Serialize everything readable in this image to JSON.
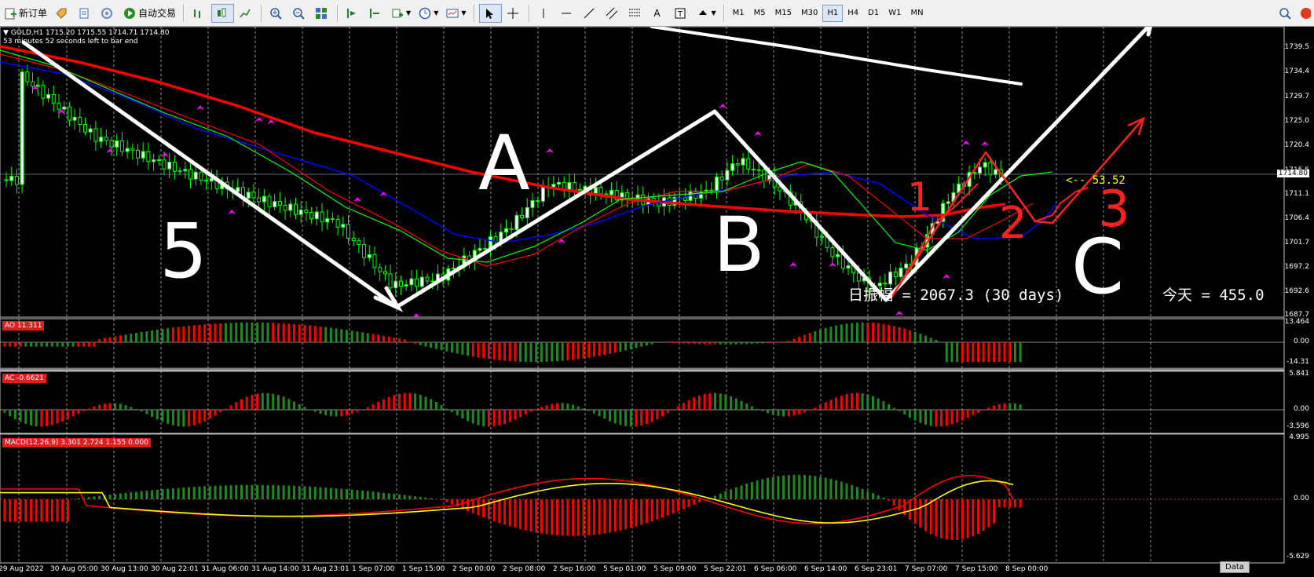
{
  "toolbar": {
    "new_order": "新订单",
    "auto_trading": "自动交易",
    "timeframes": [
      "M1",
      "M5",
      "M15",
      "M30",
      "H1",
      "H4",
      "D1",
      "W1",
      "MN"
    ],
    "active_timeframe": "H1"
  },
  "main_chart": {
    "header": "GOLD,H1  1715.20 1715.55 1714.71 1714.80",
    "timer": "53 minutes 52 seconds left to bar end",
    "price_scale": [
      "1739.5",
      "1734.4",
      "1729.7",
      "1725.0",
      "1720.4",
      "1715.5",
      "1714.80",
      "1711.1",
      "1706.4",
      "1701.7",
      "1697.2",
      "1692.6",
      "1687.7"
    ],
    "current_price": "1714.80",
    "annotation_price": "<-- 53.52",
    "footer_daily": "日振幅 = 2067.3  (30 days)",
    "footer_today": "今天 = 455.0",
    "handwriting": [
      "5",
      "A",
      "B",
      "C",
      "1",
      "2",
      "3"
    ]
  },
  "ao": {
    "badge": "AO 11.311",
    "scale": [
      "13.464",
      "0.00",
      "-14.31"
    ]
  },
  "ac": {
    "badge": "AC -0.6621",
    "scale": [
      "5.841",
      "0.00",
      "-3.596"
    ]
  },
  "macd": {
    "badge": "MACD(12,26,9) 3.301 2.724 1.155 0.000",
    "scale": [
      "4.995",
      "0.00",
      "-5.629"
    ]
  },
  "time_axis": [
    "29 Aug 2022",
    "30 Aug 05:00",
    "30 Aug 13:00",
    "30 Aug 22:01",
    "31 Aug 06:00",
    "31 Aug 14:00",
    "31 Aug 23:01",
    "1 Sep 07:00",
    "1 Sep 15:00",
    "2 Sep 00:00",
    "2 Sep 08:00",
    "2 Sep 16:00",
    "5 Sep 01:00",
    "5 Sep 09:00",
    "5 Sep 22:01",
    "6 Sep 06:00",
    "6 Sep 14:00",
    "6 Sep 23:01",
    "7 Sep 07:00",
    "7 Sep 15:00",
    "8 Sep 00:00"
  ],
  "corner_button": "Data",
  "colors": {
    "bull": "#00ff00",
    "bear": "#ff0000",
    "ma_red": "#ff0000",
    "ma_blue": "#0000ff",
    "ma_green": "#00ff00",
    "fractal": "#ff00ff",
    "yellow": "#ffff00"
  }
}
